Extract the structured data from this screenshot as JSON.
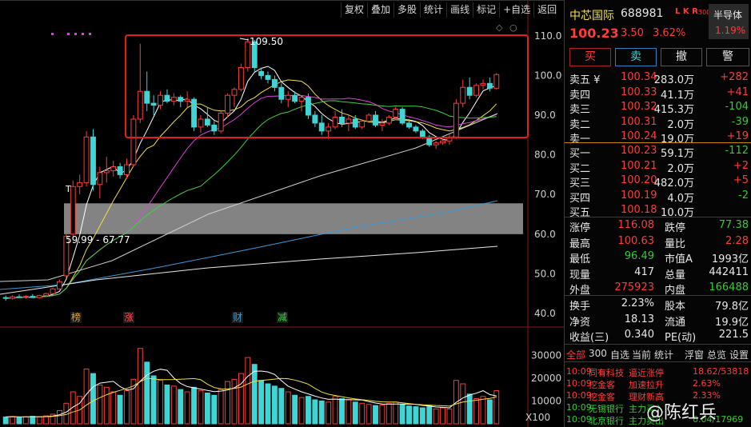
{
  "toolbar": {
    "buttons": [
      "复权",
      "叠加",
      "多股",
      "统计",
      "画线",
      "标记",
      "+自选",
      "返回"
    ]
  },
  "chart_axis": {
    "ticks": [
      "110.0",
      "100.0",
      "90.0",
      "80.0",
      "70.0",
      "60.0",
      "50.0",
      "40.0"
    ],
    "vol_ticks": [
      "30000",
      "20000",
      "10000"
    ],
    "vol_unit": "X100"
  },
  "annotations": {
    "high_label": "109.50",
    "range_label": "59.99 - 67.77",
    "marker_t": "T",
    "events": [
      "榜",
      "涨",
      "财",
      "减"
    ]
  },
  "colors": {
    "up": "#ff3b3b",
    "down": "#3fd5d5",
    "ma5": "#ffffff",
    "ma10": "#f0e040",
    "ma20": "#e040e0",
    "ma30": "#40d040",
    "ma60": "#cfcfcf",
    "ma120": "#3a9ad9",
    "highlight_box": "#e02020"
  },
  "stock": {
    "name": "中芯国际",
    "code": "688981",
    "tag": "L K R",
    "tag_sub": "300",
    "sector": "半导体",
    "sector_change": "1.19%",
    "price": "100.23",
    "change": "3.50",
    "change_pct": "3.62%"
  },
  "actions": [
    "买",
    "卖",
    "撤",
    "警"
  ],
  "sell_orders": [
    {
      "label": "卖五 ¥",
      "price": "100.34",
      "vol": "283.0万",
      "delta": "+282"
    },
    {
      "label": "卖四",
      "price": "100.33",
      "vol": "41.1万",
      "delta": "+41"
    },
    {
      "label": "卖三",
      "price": "100.32",
      "vol": "415.3万",
      "delta": "-104"
    },
    {
      "label": "卖二",
      "price": "100.31",
      "vol": "2.0万",
      "delta": "-39"
    },
    {
      "label": "卖一",
      "price": "100.24",
      "vol": "19.0万",
      "delta": "+19"
    }
  ],
  "buy_orders": [
    {
      "label": "买一",
      "price": "100.23",
      "vol": "59.1万",
      "delta": "-112"
    },
    {
      "label": "买二",
      "price": "100.21",
      "vol": "2.0万",
      "delta": "+2"
    },
    {
      "label": "买三",
      "price": "100.20",
      "vol": "482.0万",
      "delta": "+5"
    },
    {
      "label": "买四",
      "price": "100.19",
      "vol": "4.0万",
      "delta": "-2"
    },
    {
      "label": "买五",
      "price": "100.18",
      "vol": "10.0万",
      "delta": ""
    }
  ],
  "stats": [
    {
      "k1": "涨停",
      "v1": "116.08",
      "k2": "跌停",
      "v2": "77.38"
    },
    {
      "k1": "最高",
      "v1": "100.63",
      "k2": "量比",
      "v2": "2.28"
    },
    {
      "k1": "最低",
      "v1": "96.49",
      "k2": "市值A",
      "v2": "1993亿"
    },
    {
      "k1": "现量",
      "v1": "417",
      "k2": "总量",
      "v2": "442411"
    },
    {
      "k1": "外盘",
      "v1": "275923",
      "k2": "内盘",
      "v2": "166488"
    }
  ],
  "stats2": [
    {
      "k1": "换手",
      "v1": "2.23%",
      "k2": "股本",
      "v2": "79.8亿"
    },
    {
      "k1": "净资",
      "v1": "18.13",
      "k2": "流通",
      "v2": "19.9亿"
    },
    {
      "k1": "收益(三)",
      "v1": "0.340",
      "k2": "PE(动)",
      "v2": "221.5"
    }
  ],
  "tabs": [
    "全部",
    "300",
    "自选",
    "当前",
    "统计",
    "浮窗",
    "总览",
    "设置"
  ],
  "news": [
    {
      "time": "10:09",
      "name": "同有科技",
      "event": "逼近涨停",
      "val": "18.62/53818"
    },
    {
      "time": "10:09",
      "name": "挖金客",
      "event": "加速拉升",
      "val": "2.63%"
    },
    {
      "time": "10:09",
      "name": "挖金客",
      "event": "理财新高",
      "val": "2.33%"
    },
    {
      "time": "10:09",
      "name": "无锡银行",
      "event": "主力买入",
      "val": ""
    },
    {
      "time": "10:09",
      "name": "北京银行",
      "event": "主力卖出",
      "val": "6.04/17969"
    }
  ],
  "watermark": "@陈红兵",
  "chart_data": {
    "type": "candlestick",
    "ohlc": [
      [
        44.0,
        44.5,
        43.2,
        43.8
      ],
      [
        43.8,
        44.6,
        43.5,
        44.2
      ],
      [
        44.2,
        44.8,
        43.9,
        44.1
      ],
      [
        44.1,
        44.6,
        43.7,
        44.3
      ],
      [
        44.3,
        44.9,
        44.0,
        44.0
      ],
      [
        44.0,
        44.7,
        43.8,
        44.5
      ],
      [
        44.5,
        45.2,
        44.2,
        45.0
      ],
      [
        45.0,
        46.5,
        44.8,
        46.2
      ],
      [
        46.2,
        48.5,
        46.0,
        48.0
      ],
      [
        49.5,
        60.0,
        49.0,
        59.5
      ],
      [
        60.0,
        73.5,
        59.0,
        72.0
      ],
      [
        72.0,
        75.0,
        70.0,
        73.0
      ],
      [
        73.0,
        86.0,
        72.0,
        84.5
      ],
      [
        84.5,
        86.5,
        71.0,
        72.5
      ],
      [
        72.5,
        77.0,
        69.0,
        75.5
      ],
      [
        75.5,
        79.5,
        73.0,
        76.0
      ],
      [
        76.0,
        78.5,
        74.5,
        77.0
      ],
      [
        77.0,
        78.0,
        74.0,
        75.0
      ],
      [
        75.0,
        79.0,
        74.0,
        77.5
      ],
      [
        77.5,
        90.0,
        77.0,
        89.0
      ],
      [
        89.0,
        108.0,
        88.0,
        96.0
      ],
      [
        96.0,
        101.0,
        91.0,
        93.0
      ],
      [
        93.0,
        95.0,
        90.0,
        92.5
      ],
      [
        92.5,
        96.0,
        91.5,
        95.0
      ],
      [
        95.0,
        96.5,
        93.0,
        93.5
      ],
      [
        93.5,
        95.5,
        92.5,
        94.5
      ],
      [
        94.5,
        95.0,
        92.0,
        93.5
      ],
      [
        93.5,
        96.0,
        92.0,
        94.0
      ],
      [
        94.0,
        94.5,
        86.0,
        87.0
      ],
      [
        87.0,
        90.0,
        85.5,
        89.0
      ],
      [
        89.0,
        92.0,
        87.0,
        87.5
      ],
      [
        87.5,
        88.5,
        85.0,
        86.0
      ],
      [
        86.0,
        91.0,
        85.5,
        90.5
      ],
      [
        90.5,
        95.5,
        89.5,
        95.0
      ],
      [
        95.0,
        97.0,
        92.0,
        96.5
      ],
      [
        96.5,
        103.0,
        96.0,
        102.0
      ],
      [
        102.0,
        109.5,
        101.0,
        108.5
      ],
      [
        108.5,
        109.0,
        101.0,
        102.0
      ],
      [
        101.0,
        102.0,
        99.0,
        100.0
      ],
      [
        100.0,
        101.0,
        98.0,
        99.0
      ],
      [
        99.0,
        100.0,
        96.0,
        97.0
      ],
      [
        97.0,
        98.0,
        93.0,
        94.0
      ],
      [
        94.0,
        96.0,
        92.0,
        95.0
      ],
      [
        95.0,
        96.0,
        93.0,
        93.5
      ],
      [
        93.5,
        95.0,
        91.0,
        94.5
      ],
      [
        94.5,
        95.5,
        89.0,
        90.0
      ],
      [
        90.0,
        91.0,
        87.0,
        88.0
      ],
      [
        88.0,
        90.0,
        85.0,
        86.0
      ],
      [
        86.0,
        88.0,
        84.0,
        87.0
      ],
      [
        87.0,
        91.0,
        86.5,
        89.5
      ],
      [
        89.5,
        91.5,
        87.0,
        88.0
      ],
      [
        88.0,
        90.0,
        86.0,
        89.0
      ],
      [
        89.0,
        90.0,
        86.5,
        87.0
      ],
      [
        87.0,
        89.0,
        86.5,
        88.5
      ],
      [
        88.5,
        90.5,
        88.0,
        90.0
      ],
      [
        90.0,
        91.0,
        87.0,
        87.5
      ],
      [
        87.5,
        89.0,
        86.0,
        88.0
      ],
      [
        88.0,
        90.0,
        87.5,
        89.5
      ],
      [
        89.5,
        92.0,
        89.0,
        91.5
      ],
      [
        91.5,
        92.0,
        87.5,
        88.0
      ],
      [
        88.0,
        89.0,
        86.5,
        87.0
      ],
      [
        87.0,
        87.5,
        85.5,
        86.0
      ],
      [
        86.0,
        86.5,
        84.0,
        84.5
      ],
      [
        84.5,
        85.0,
        82.0,
        82.5
      ],
      [
        82.5,
        83.5,
        81.5,
        83.0
      ],
      [
        83.0,
        84.0,
        82.5,
        83.5
      ],
      [
        83.5,
        85.0,
        82.5,
        84.5
      ],
      [
        84.5,
        94.0,
        84.0,
        93.0
      ],
      [
        93.0,
        99.0,
        92.0,
        97.0
      ],
      [
        97.0,
        99.5,
        94.0,
        95.0
      ],
      [
        95.0,
        98.0,
        94.5,
        97.5
      ],
      [
        97.5,
        99.0,
        96.5,
        98.0
      ],
      [
        98.0,
        99.5,
        96.0,
        96.8
      ],
      [
        96.8,
        100.63,
        96.49,
        100.23
      ]
    ],
    "volume_x100": [
      3000,
      3200,
      2800,
      3100,
      3300,
      3000,
      3500,
      4200,
      5800,
      9000,
      14000,
      12000,
      24000,
      22000,
      17000,
      16000,
      14000,
      12500,
      14500,
      19500,
      33000,
      27000,
      21000,
      19000,
      17000,
      16500,
      15000,
      14000,
      16000,
      14500,
      13500,
      12500,
      15000,
      18500,
      19500,
      22000,
      29000,
      26000,
      19000,
      17500,
      16500,
      15500,
      14000,
      12500,
      11500,
      12000,
      10500,
      10000,
      9500,
      12000,
      11000,
      10500,
      9500,
      9000,
      8500,
      8000,
      8200,
      9000,
      9500,
      8500,
      7800,
      7500,
      7000,
      8000,
      6500,
      7000,
      6500,
      19000,
      17500,
      13000,
      11000,
      12000,
      10500,
      14500
    ],
    "ylim": [
      38,
      112
    ],
    "high_label": "109.50",
    "support_band": [
      59.99,
      67.77
    ]
  }
}
